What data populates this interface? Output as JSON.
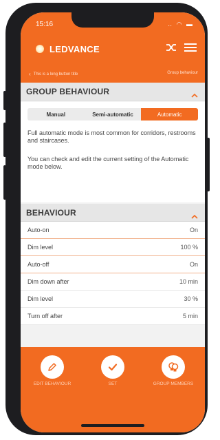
{
  "status_bar": {
    "time": "15:16",
    "icons": "‥ ◠ ▬"
  },
  "header": {
    "brand": "LEDVANCE",
    "icons": [
      "link-icon",
      "menu-icon"
    ],
    "back_label": "This is a long button title",
    "nav_right": "Group behaviour"
  },
  "group_behaviour": {
    "title": "GROUP BEHAVIOUR",
    "modes": [
      "Manual",
      "Semi-automatic",
      "Automatic"
    ],
    "selected_mode": "Automatic",
    "description_1": "Full automatic mode is most common for corridors, restrooms and staircases.",
    "description_2": "You can check and edit the current setting of the Automatic mode below."
  },
  "behaviour": {
    "title": "BEHAVIOUR",
    "rows": [
      {
        "label": "Auto-on",
        "value": "On"
      },
      {
        "label": "Dim level",
        "value": "100 %"
      },
      {
        "label": "Auto-off",
        "value": "On"
      },
      {
        "label": "Dim down after",
        "value": "10 min"
      },
      {
        "label": "Dim level",
        "value": "30 %"
      },
      {
        "label": "Turn off after",
        "value": "5 min"
      }
    ]
  },
  "footer": {
    "buttons": [
      {
        "label": "EDIT BEHAVIOUR",
        "icon": "pencil-icon"
      },
      {
        "label": "SET",
        "icon": "checkmark-icon"
      },
      {
        "label": "GROUP MEMBERS",
        "icon": "bulbs-icon"
      }
    ]
  },
  "colors": {
    "accent": "#f26b21",
    "section_bg": "#e6e6e6",
    "text": "#444444"
  }
}
